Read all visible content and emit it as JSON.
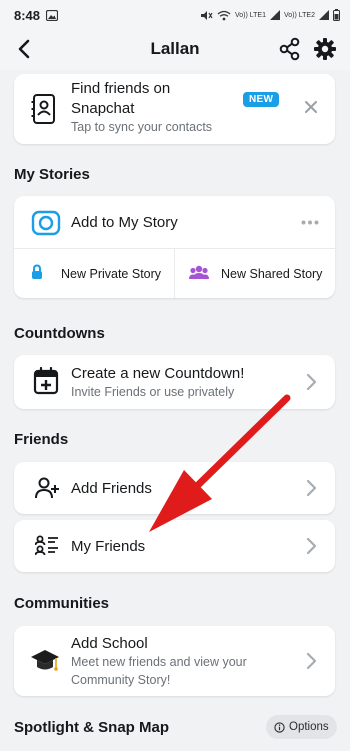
{
  "status_bar": {
    "time": "8:48",
    "net_label_1": "Vo)) LTE1",
    "net_label_2": "Vo)) LTE2"
  },
  "header": {
    "title": "Lallan"
  },
  "find_friends": {
    "title_line1": "Find friends on",
    "title_line2": "Snapchat",
    "subtitle": "Tap to sync your contacts",
    "badge": "NEW"
  },
  "my_stories": {
    "section": "My Stories",
    "add_story": "Add to My Story",
    "private_story": "New Private Story",
    "shared_story": "New Shared Story"
  },
  "countdowns": {
    "section": "Countdowns",
    "title": "Create a new Countdown!",
    "subtitle": "Invite Friends or use privately"
  },
  "friends": {
    "section": "Friends",
    "add_friends": "Add Friends",
    "my_friends": "My Friends"
  },
  "communities": {
    "section": "Communities",
    "title": "Add School",
    "subtitle_line1": "Meet new friends and view your",
    "subtitle_line2": "Community Story!"
  },
  "spotlight": {
    "section": "Spotlight & Snap Map",
    "options_label": "Options"
  },
  "colors": {
    "accent_blue": "#1a9ee6",
    "arrow_red": "#e01b1b",
    "background": "#f1f2f4"
  }
}
